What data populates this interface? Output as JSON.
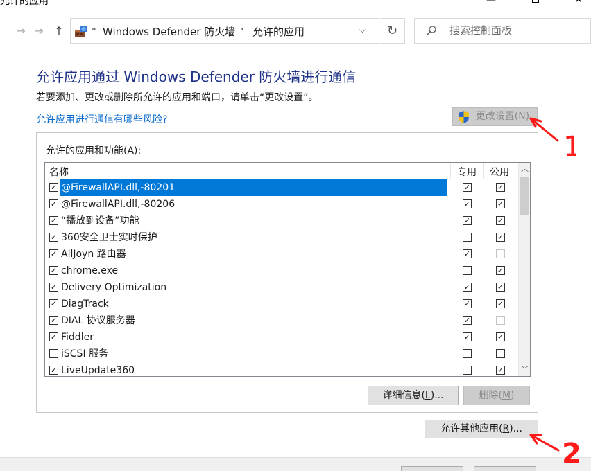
{
  "window": {
    "title": "允许的应用"
  },
  "address": {
    "crumb_root": "Windows Defender 防火墙",
    "crumb_current": "允许的应用"
  },
  "search": {
    "placeholder": "搜索控制面板"
  },
  "content": {
    "title": "允许应用通过 Windows Defender 防火墙进行通信",
    "subtitle": "若要添加、更改或删除所允许的应用和端口，请单击“更改设置”。",
    "risk_link": "允许应用进行通信有哪些风险?",
    "change_settings": "更改设置(N)",
    "group_label": "允许的应用和功能(A):"
  },
  "table": {
    "columns": {
      "name": "名称",
      "private": "专用",
      "public": "公用"
    },
    "rows": [
      {
        "name": "@FirewallAPI.dll,-80201",
        "enabled": true,
        "private": true,
        "public": true,
        "selected": true
      },
      {
        "name": "@FirewallAPI.dll,-80206",
        "enabled": true,
        "private": true,
        "public": true,
        "selected": false
      },
      {
        "name": "“播放到设备”功能",
        "enabled": true,
        "private": true,
        "public": true,
        "selected": false
      },
      {
        "name": "360安全卫士实时保护",
        "enabled": true,
        "private": false,
        "public": true,
        "selected": false
      },
      {
        "name": "AllJoyn 路由器",
        "enabled": true,
        "private": true,
        "public": false,
        "selected": false
      },
      {
        "name": "chrome.exe",
        "enabled": true,
        "private": false,
        "public": true,
        "selected": false
      },
      {
        "name": "Delivery Optimization",
        "enabled": true,
        "private": true,
        "public": true,
        "selected": false
      },
      {
        "name": "DiagTrack",
        "enabled": true,
        "private": true,
        "public": true,
        "selected": false
      },
      {
        "name": "DIAL 协议服务器",
        "enabled": true,
        "private": true,
        "public": false,
        "selected": false
      },
      {
        "name": "Fiddler",
        "enabled": true,
        "private": true,
        "public": true,
        "selected": false
      },
      {
        "name": "iSCSI 服务",
        "enabled": false,
        "private": false,
        "public": false,
        "selected": false
      },
      {
        "name": "LiveUpdate360",
        "enabled": true,
        "private": false,
        "public": true,
        "selected": false
      }
    ]
  },
  "buttons": {
    "details_text": "详细信息(",
    "details_key": "L",
    "details_tail": ")...",
    "delete_text": "删除(",
    "delete_key": "M",
    "delete_tail": ")",
    "allow_text": "允许其他应用(",
    "allow_key": "R",
    "allow_tail": ")..."
  },
  "annotations": {
    "mark_1": "1",
    "mark_2": "2",
    "color": "#ff1a1a"
  },
  "colors": {
    "title": "#1e3287",
    "link": "#0066cc",
    "selection": "#0078d7"
  }
}
